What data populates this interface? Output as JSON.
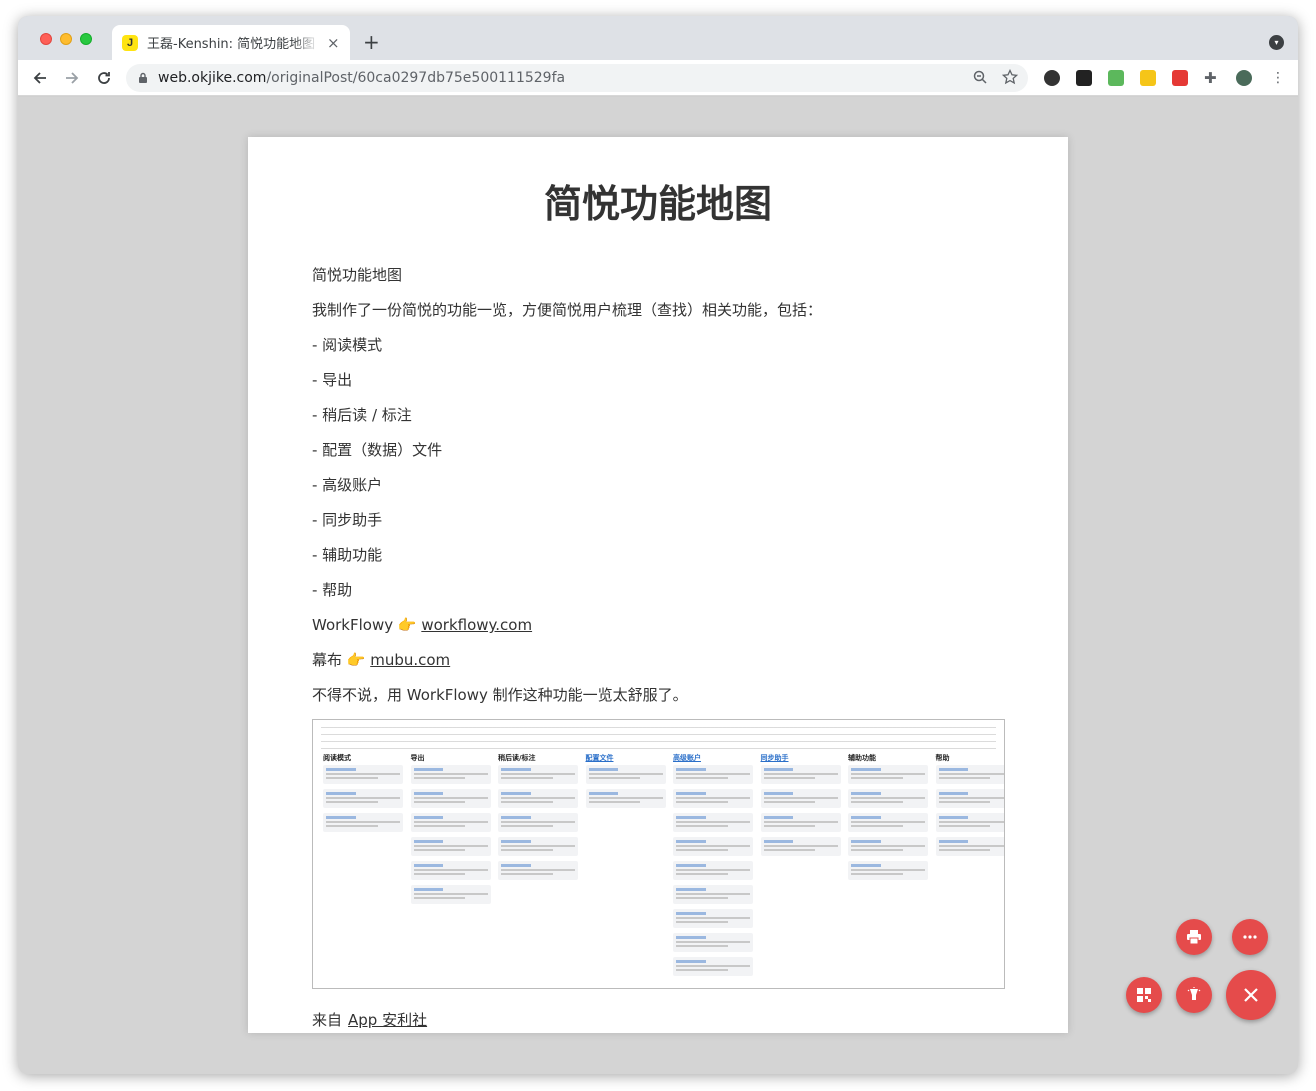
{
  "browser": {
    "tab_title": "王磊-Kenshin: 简悦功能地图 我制作了一份简悦的功能一览",
    "tab_close": "×",
    "new_tab": "+",
    "url_host": "web.okjike.com",
    "url_path": "/originalPost/60ca0297db75e500111529fa"
  },
  "article": {
    "title": "简悦功能地图",
    "paragraphs": [
      "简悦功能地图",
      "我制作了一份简悦的功能一览，方便简悦用户梳理（查找）相关功能，包括：",
      "- 阅读模式",
      "- 导出",
      "- 稍后读 / 标注",
      "- 配置（数据）文件",
      "- 高级账户",
      "- 同步助手",
      "- 辅助功能",
      "- 帮助"
    ],
    "workflowy_prefix": "WorkFlowy 👉 ",
    "workflowy_link": "workflowy.com",
    "mubu_prefix": "幕布 👉 ",
    "mubu_link": "mubu.com",
    "closing": "不得不说，用 WorkFlowy 制作这种功能一览太舒服了。",
    "source_prefix": "来自",
    "source_link": "App 安利社"
  },
  "screenshot_columns": [
    {
      "title": "阅读模式",
      "link": false,
      "cards": 3
    },
    {
      "title": "导出",
      "link": false,
      "cards": 6
    },
    {
      "title": "稍后读/标注",
      "link": false,
      "cards": 5
    },
    {
      "title": "配置文件",
      "link": true,
      "cards": 2
    },
    {
      "title": "高级账户",
      "link": true,
      "cards": 9
    },
    {
      "title": "同步助手",
      "link": true,
      "cards": 4
    },
    {
      "title": "辅助功能",
      "link": false,
      "cards": 5
    },
    {
      "title": "帮助",
      "link": false,
      "cards": 4
    }
  ],
  "colors": {
    "fab": "#e54b4b",
    "link_blue": "#2a6fc9"
  },
  "icons": {
    "fab_print": "printer-icon",
    "fab_more": "more-icon",
    "fab_qr": "qrcode-icon",
    "fab_focus": "lightbulb-icon",
    "fab_close": "close-icon"
  }
}
